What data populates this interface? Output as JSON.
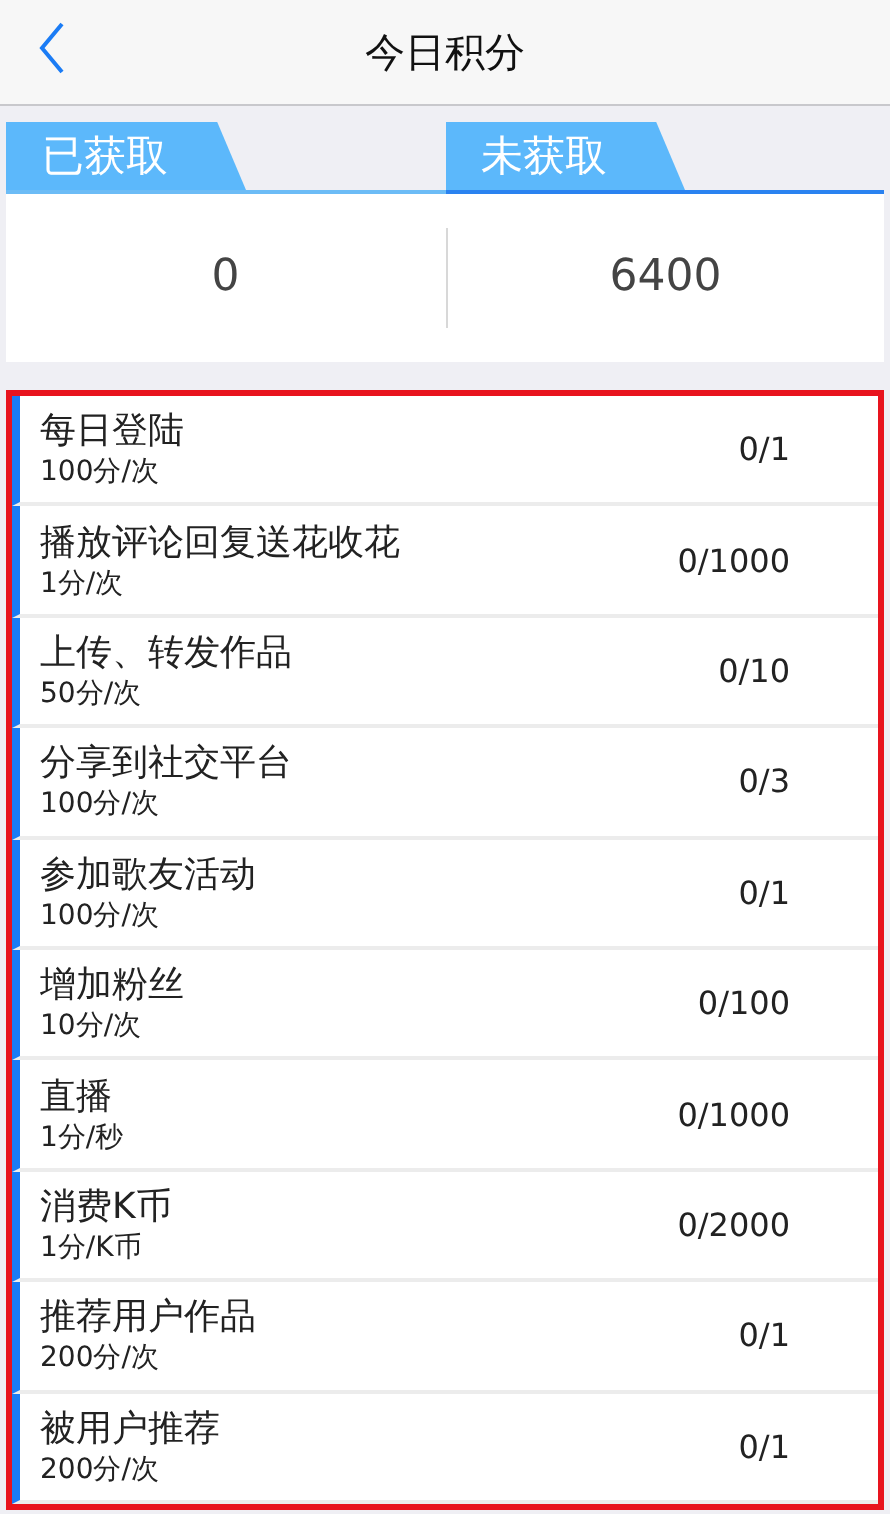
{
  "nav": {
    "title": "今日积分"
  },
  "tabs": [
    {
      "label": "已获取",
      "value": "0",
      "selected": false
    },
    {
      "label": "未获取",
      "value": "6400",
      "selected": true
    }
  ],
  "tasks": [
    {
      "name": "每日登陆",
      "rate": "100分/次",
      "progress": "0/1"
    },
    {
      "name": "播放评论回复送花收花",
      "rate": "1分/次",
      "progress": "0/1000"
    },
    {
      "name": "上传、转发作品",
      "rate": "50分/次",
      "progress": "0/10"
    },
    {
      "name": "分享到社交平台",
      "rate": "100分/次",
      "progress": "0/3"
    },
    {
      "name": "参加歌友活动",
      "rate": "100分/次",
      "progress": "0/1"
    },
    {
      "name": "增加粉丝",
      "rate": "10分/次",
      "progress": "0/100"
    },
    {
      "name": "直播",
      "rate": "1分/秒",
      "progress": "0/1000"
    },
    {
      "name": "消费K币",
      "rate": "1分/K币",
      "progress": "0/2000"
    },
    {
      "name": "推荐用户作品",
      "rate": "200分/次",
      "progress": "0/1"
    },
    {
      "name": "被用户推荐",
      "rate": "200分/次",
      "progress": "0/1"
    }
  ]
}
